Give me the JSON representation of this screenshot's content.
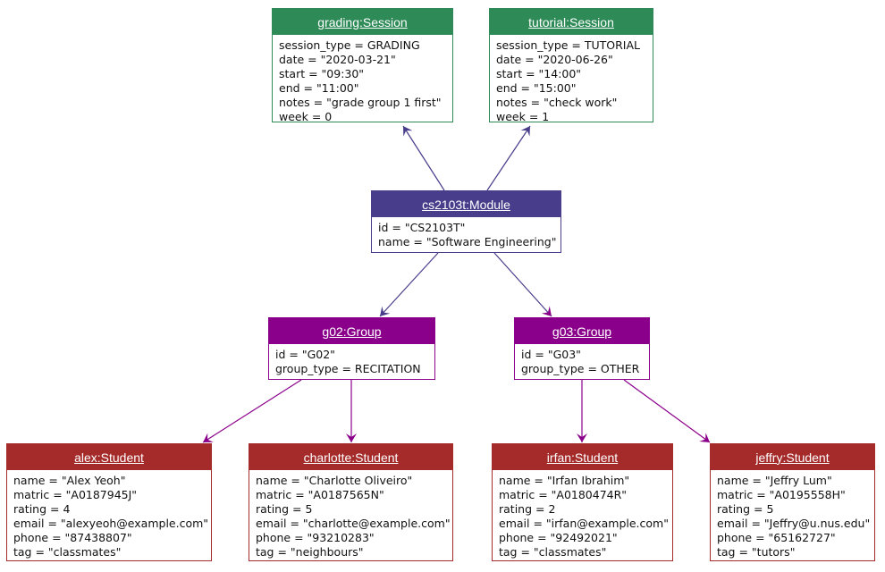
{
  "colors": {
    "session": "#2e8b57",
    "module": "#483d8b",
    "group": "#8b008b",
    "student": "#a52a2a"
  },
  "objects": {
    "grading": {
      "title": "grading:Session",
      "attrs": [
        "session_type = GRADING",
        "date = \"2020-03-21\"",
        "start = \"09:30\"",
        "end = \"11:00\"",
        "notes = \"grade group 1 first\"",
        "week = 0"
      ]
    },
    "tutorial": {
      "title": "tutorial:Session",
      "attrs": [
        "session_type = TUTORIAL",
        "date = \"2020-06-26\"",
        "start = \"14:00\"",
        "end = \"15:00\"",
        "notes = \"check work\"",
        "week = 1"
      ]
    },
    "module": {
      "title": "cs2103t:Module",
      "attrs": [
        "id = \"CS2103T\"",
        "name = \"Software Engineering\""
      ]
    },
    "g02": {
      "title": "g02:Group",
      "attrs": [
        "id = \"G02\"",
        "group_type = RECITATION"
      ]
    },
    "g03": {
      "title": "g03:Group",
      "attrs": [
        "id = \"G03\"",
        "group_type = OTHER"
      ]
    },
    "alex": {
      "title": "alex:Student",
      "attrs": [
        "name = \"Alex Yeoh\"",
        "matric = \"A0187945J\"",
        "rating = 4",
        "email = \"alexyeoh@example.com\"",
        "phone = \"87438807\"",
        "tag = \"classmates\""
      ]
    },
    "charlotte": {
      "title": "charlotte:Student",
      "attrs": [
        "name = \"Charlotte Oliveiro\"",
        "matric = \"A0187565N\"",
        "rating = 5",
        "email = \"charlotte@example.com\"",
        "phone = \"93210283\"",
        "tag = \"neighbours\""
      ]
    },
    "irfan": {
      "title": "irfan:Student",
      "attrs": [
        "name = \"Irfan Ibrahim\"",
        "matric = \"A0180474R\"",
        "rating = 2",
        "email = \"irfan@example.com\"",
        "phone = \"92492021\"",
        "tag = \"classmates\""
      ]
    },
    "jeffry": {
      "title": "jeffry:Student",
      "attrs": [
        "name = \"Jeffry Lum\"",
        "matric = \"A0195558H\"",
        "rating = 5",
        "email = \"Jeffry@u.nus.edu\"",
        "phone = \"65162727\"",
        "tag = \"tutors\""
      ]
    }
  },
  "edges": [
    {
      "from": "module",
      "to": "grading"
    },
    {
      "from": "module",
      "to": "tutorial"
    },
    {
      "from": "module",
      "to": "g02"
    },
    {
      "from": "module",
      "to": "g03"
    },
    {
      "from": "g02",
      "to": "alex"
    },
    {
      "from": "g02",
      "to": "charlotte"
    },
    {
      "from": "g03",
      "to": "irfan"
    },
    {
      "from": "g03",
      "to": "jeffry"
    }
  ]
}
